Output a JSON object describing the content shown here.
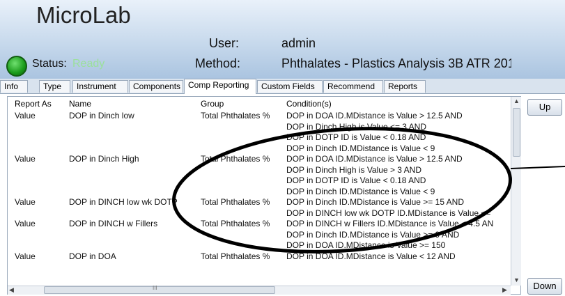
{
  "app": {
    "title": "MicroLab"
  },
  "user": {
    "label": "User:",
    "value": "admin"
  },
  "status": {
    "label": "Status:",
    "value": "Ready",
    "color": "#9be09b",
    "indicator": "green-status-dot"
  },
  "method": {
    "label": "Method:",
    "value": "Phthalates - Plastics Analysis 3B ATR 201"
  },
  "tabs": [
    "Info",
    "Type",
    "Instrument",
    "Components",
    "Comp Reporting",
    "Custom Fields",
    "Recommend",
    "Reports"
  ],
  "active_tab": "Comp Reporting",
  "grid": {
    "headers": {
      "report_as": "Report As",
      "name": "Name",
      "group": "Group",
      "conditions": "Condition(s)"
    },
    "rows": [
      {
        "report_as": "Value",
        "name": "DOP in Dinch low",
        "group": "Total Phthalates %",
        "conditions": [
          "DOP in DOA ID.MDistance is Value > 12.5 AND",
          "DOP in Dinch High is Value <= 3 AND",
          "DOP in DOTP ID is Value < 0.18 AND",
          "DOP in Dinch ID.MDistance is Value < 9"
        ]
      },
      {
        "report_as": "Value",
        "name": "DOP in Dinch High",
        "group": "Total Phthalates %",
        "conditions": [
          "DOP in DOA ID.MDistance is Value > 12.5 AND",
          "DOP in Dinch High is Value > 3 AND",
          "DOP in DOTP ID is Value < 0.18 AND",
          "DOP in Dinch ID.MDistance is Value < 9"
        ]
      },
      {
        "report_as": "Value",
        "name": "DOP in DINCH low wk DOTP",
        "group": "Total Phthalates %",
        "conditions": [
          "DOP in Dinch ID.MDistance is Value >= 15 AND",
          "DOP in DINCH low wk DOTP ID.MDistance is Value <="
        ]
      },
      {
        "report_as": "Value",
        "name": "DOP in DINCH w Fillers",
        "group": "Total Phthalates %",
        "conditions": [
          "DOP in DINCH w Fillers ID.MDistance is Value < 4.5 AN",
          "DOP in Dinch ID.MDistance is Value >= 9 AND",
          "DOP in DOA ID.MDistance is Value >= 150"
        ]
      },
      {
        "report_as": "Value",
        "name": "DOP in DOA",
        "group": "Total Phthalates %",
        "conditions": [
          "DOP in DOA ID.MDistance is Value < 12 AND"
        ]
      }
    ]
  },
  "buttons": {
    "up": "Up",
    "down": "Down"
  },
  "scroll": {
    "horizontal_grip": "III"
  },
  "annotation": {
    "shape": "hand-drawn-ellipse"
  }
}
